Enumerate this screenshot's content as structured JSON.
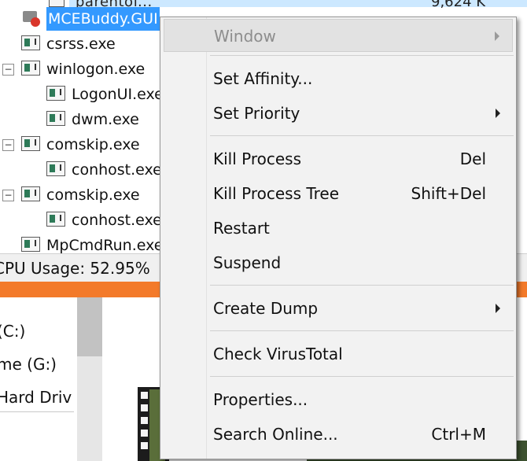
{
  "tree": {
    "top_partial_text": "parentof...",
    "top_partial_right": "9,624 K",
    "rows": [
      {
        "label": "MCEBuddy.GUI"
      },
      {
        "label": "csrss.exe"
      },
      {
        "label": "winlogon.exe"
      },
      {
        "label": "LogonUI.exe"
      },
      {
        "label": "dwm.exe"
      },
      {
        "label": "comskip.exe"
      },
      {
        "label": "conhost.exe"
      },
      {
        "label": "comskip.exe"
      },
      {
        "label": "conhost.exe"
      },
      {
        "label": "MpCmdRun.exe"
      }
    ],
    "expander_symbol": "−"
  },
  "statusbar": {
    "cpu_usage": "CPU Usage: 52.95%"
  },
  "explorer": {
    "drives": [
      {
        "label": "(C:)"
      },
      {
        "label": "me (G:)"
      },
      {
        "label": "Hard Driv"
      }
    ]
  },
  "context_menu": {
    "items": [
      {
        "label": "Window",
        "shortcut": ""
      },
      {
        "label": "Set Affinity...",
        "shortcut": ""
      },
      {
        "label": "Set Priority",
        "shortcut": ""
      },
      {
        "label": "Kill Process",
        "shortcut": "Del"
      },
      {
        "label": "Kill Process Tree",
        "shortcut": "Shift+Del"
      },
      {
        "label": "Restart",
        "shortcut": ""
      },
      {
        "label": "Suspend",
        "shortcut": ""
      },
      {
        "label": "Create Dump",
        "shortcut": ""
      },
      {
        "label": "Check VirusTotal",
        "shortcut": ""
      },
      {
        "label": "Properties...",
        "shortcut": ""
      },
      {
        "label": "Search Online...",
        "shortcut": "Ctrl+M"
      }
    ]
  },
  "colors": {
    "selection": "#3399ff",
    "orange_bar": "#f37a2a",
    "menu_bg": "#f2f2f2"
  }
}
